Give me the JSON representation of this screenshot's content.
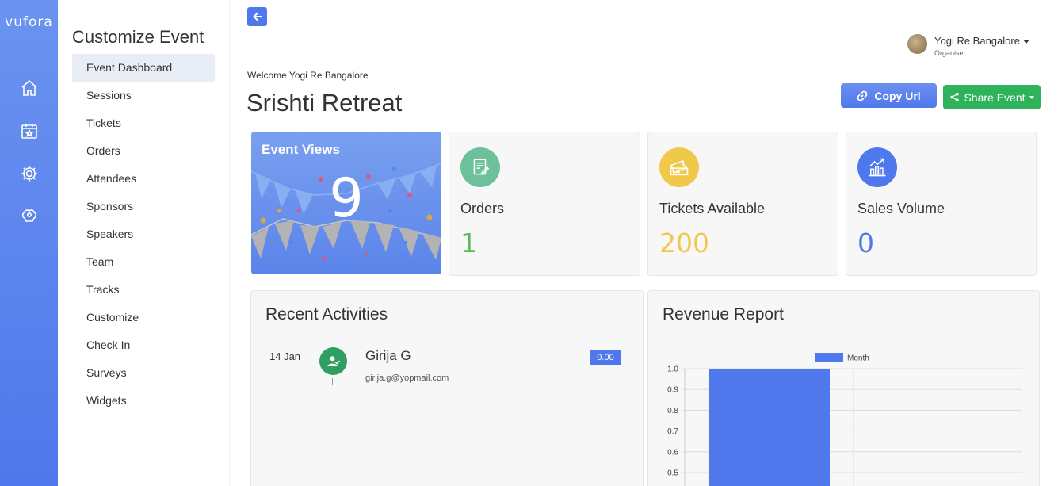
{
  "brand": {
    "logo_text": "vufora"
  },
  "rail": {
    "icons": [
      "home-icon",
      "calendar-star-icon",
      "gear-icon",
      "brain-gear-icon"
    ]
  },
  "sidebar": {
    "title": "Customize Event",
    "items": [
      {
        "label": "Event Dashboard",
        "active": true
      },
      {
        "label": "Sessions"
      },
      {
        "label": "Tickets"
      },
      {
        "label": "Orders"
      },
      {
        "label": "Attendees"
      },
      {
        "label": "Sponsors"
      },
      {
        "label": "Speakers"
      },
      {
        "label": "Team"
      },
      {
        "label": "Tracks"
      },
      {
        "label": "Customize"
      },
      {
        "label": "Check In"
      },
      {
        "label": "Surveys"
      },
      {
        "label": "Widgets"
      }
    ]
  },
  "user": {
    "name": "Yogi Re Bangalore",
    "role": "Organiser"
  },
  "header": {
    "welcome": "Welcome Yogi Re Bangalore",
    "event_title": "Srishti Retreat",
    "copy_url_label": "Copy Url",
    "share_event_label": "Share Event"
  },
  "stats": {
    "views": {
      "label": "Event Views",
      "value": "9"
    },
    "orders": {
      "label": "Orders",
      "value": "1",
      "color": "#5cb85c"
    },
    "tickets": {
      "label": "Tickets Available",
      "value": "200",
      "color": "#f0c94a"
    },
    "sales": {
      "label": "Sales Volume",
      "value": "0",
      "color": "#4f78ec"
    }
  },
  "recent": {
    "title": "Recent Activities",
    "items": [
      {
        "date": "14 Jan",
        "name": "Girija G",
        "email": "girija.g@yopmail.com",
        "amount": "0.00"
      }
    ]
  },
  "revenue": {
    "title": "Revenue Report"
  },
  "chart_data": {
    "type": "bar",
    "categories": [
      ""
    ],
    "series": [
      {
        "name": "Month",
        "values": [
          1.0
        ]
      }
    ],
    "ylim": [
      0.5,
      1.0
    ],
    "yticks": [
      "1.0",
      "0.9",
      "0.8",
      "0.7",
      "0.6",
      "0.5"
    ],
    "legend": "top",
    "grid": true,
    "bar_color": "#4f78ec"
  }
}
